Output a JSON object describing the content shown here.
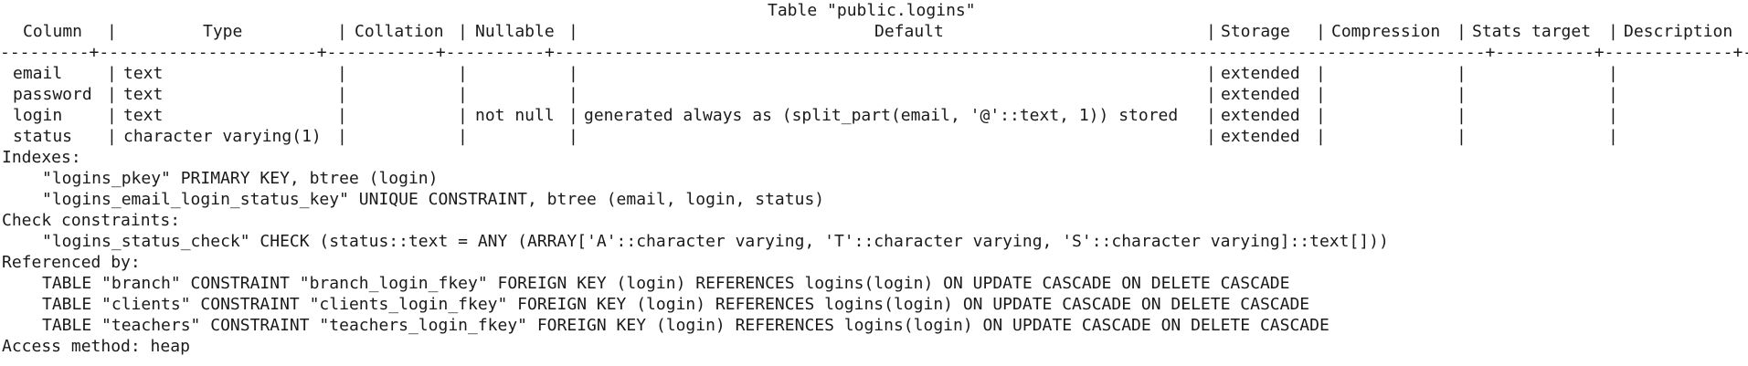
{
  "title": "Table \"public.logins\"",
  "headers": [
    "Column",
    "Type",
    "Collation",
    "Nullable",
    "Default",
    "Storage",
    "Compression",
    "Stats target",
    "Description"
  ],
  "rule": "---------+----------------------+-----------+----------+----------------------------------------------------------------------------------------------+----------+-------------+--------------+-------------",
  "rows": [
    {
      "column": "email",
      "type": "text",
      "collation": "",
      "nullable": "",
      "default": "",
      "storage": "extended",
      "compression": "",
      "stats": "",
      "description": ""
    },
    {
      "column": "password",
      "type": "text",
      "collation": "",
      "nullable": "",
      "default": "",
      "storage": "extended",
      "compression": "",
      "stats": "",
      "description": ""
    },
    {
      "column": "login",
      "type": "text",
      "collation": "",
      "nullable": "not null",
      "default": "generated always as (split_part(email, '@'::text, 1)) stored",
      "storage": "extended",
      "compression": "",
      "stats": "",
      "description": ""
    },
    {
      "column": "status",
      "type": "character varying(1)",
      "collation": "",
      "nullable": "",
      "default": "",
      "storage": "extended",
      "compression": "",
      "stats": "",
      "description": ""
    }
  ],
  "indexes_label": "Indexes:",
  "indexes": [
    "\"logins_pkey\" PRIMARY KEY, btree (login)",
    "\"logins_email_login_status_key\" UNIQUE CONSTRAINT, btree (email, login, status)"
  ],
  "check_label": "Check constraints:",
  "checks": [
    "\"logins_status_check\" CHECK (status::text = ANY (ARRAY['A'::character varying, 'T'::character varying, 'S'::character varying]::text[]))"
  ],
  "referenced_label": "Referenced by:",
  "referenced": [
    "TABLE \"branch\" CONSTRAINT \"branch_login_fkey\" FOREIGN KEY (login) REFERENCES logins(login) ON UPDATE CASCADE ON DELETE CASCADE",
    "TABLE \"clients\" CONSTRAINT \"clients_login_fkey\" FOREIGN KEY (login) REFERENCES logins(login) ON UPDATE CASCADE ON DELETE CASCADE",
    "TABLE \"teachers\" CONSTRAINT \"teachers_login_fkey\" FOREIGN KEY (login) REFERENCES logins(login) ON UPDATE CASCADE ON DELETE CASCADE"
  ],
  "access_method": "Access method: heap"
}
